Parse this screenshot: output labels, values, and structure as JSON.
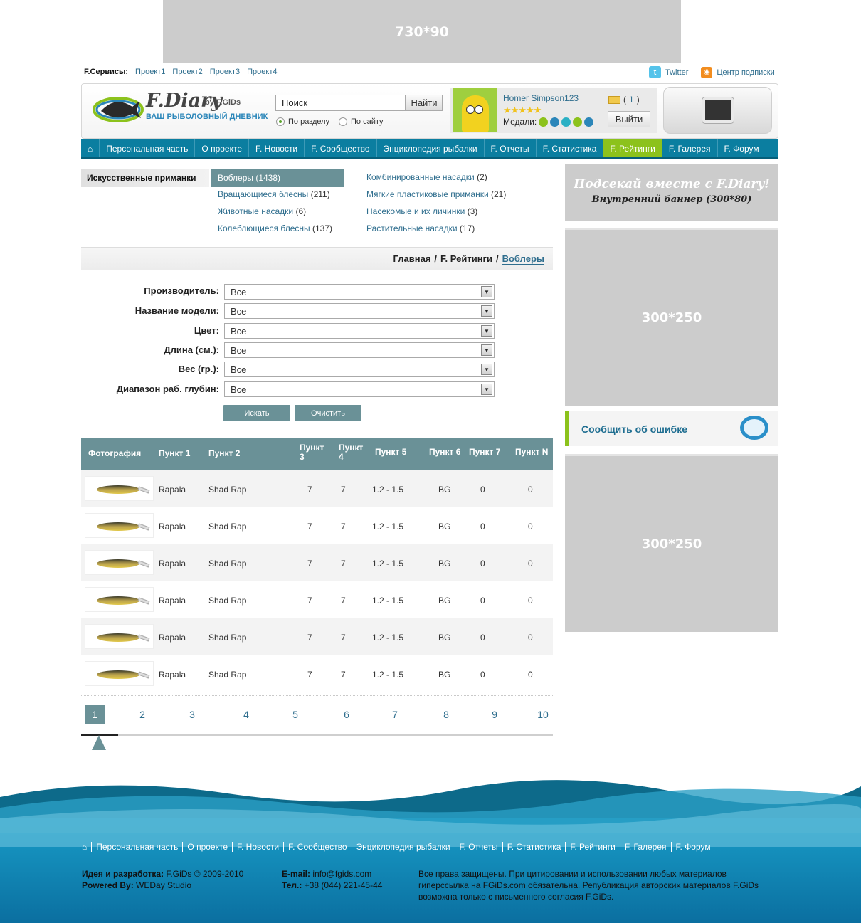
{
  "top_banner": "730*90",
  "services": {
    "label": "F.Сервисы:",
    "links": [
      "Проект1",
      "Проект2",
      "Проект3",
      "Проект4"
    ]
  },
  "social": {
    "twitter": "Twitter",
    "rss": "Центр подписки"
  },
  "logo": {
    "title": "F.Diary",
    "by": "by F.GiDs",
    "subtitle": "ВАШ РЫБОЛОВНЫЙ ДНЕВНИК"
  },
  "search": {
    "value": "Поиск",
    "button": "Найти",
    "radio1": "По разделу",
    "radio2": "По сайту"
  },
  "user": {
    "name": "Homer Simpson123",
    "medals_label": "Медали:",
    "messages": "1",
    "logout": "Выйти"
  },
  "nav": [
    "Персональная часть",
    "О проекте",
    "F. Новости",
    "F. Сообщество",
    "Энциклопедия рыбалки",
    "F. Отчеты",
    "F. Статистика",
    "F. Рейтинги",
    "F. Галерея",
    "F. Форум"
  ],
  "categories": {
    "label": "Искусственные приманки",
    "active": "Воблеры (1438)",
    "col1": [
      {
        "name": "Вращающиеся блесны",
        "count": "(211)"
      },
      {
        "name": "Животные насадки",
        "count": "(6)"
      },
      {
        "name": "Колеблющиеся блесны",
        "count": "(137)"
      }
    ],
    "col2": [
      {
        "name": "Комбинированные насадки",
        "count": "(2)"
      },
      {
        "name": "Мягкие пластиковые приманки",
        "count": "(21)"
      },
      {
        "name": "Насекомые и их личинки",
        "count": "(3)"
      },
      {
        "name": "Растительные насадки",
        "count": "(17)"
      }
    ]
  },
  "breadcrumb": {
    "home": "Главная",
    "sep": "/",
    "section": "F. Рейтинги",
    "current": "Воблеры"
  },
  "filters": [
    {
      "label": "Производитель:",
      "value": "Все"
    },
    {
      "label": "Название модели:",
      "value": "Все"
    },
    {
      "label": "Цвет:",
      "value": "Все"
    },
    {
      "label": "Длина (см.):",
      "value": "Все"
    },
    {
      "label": "Вес (гр.):",
      "value": "Все"
    },
    {
      "label": "Диапазон раб. глубин:",
      "value": "Все"
    }
  ],
  "buttons": {
    "search": "Искать",
    "clear": "Очистить"
  },
  "table": {
    "headers": [
      "Фотография",
      "Пункт 1",
      "Пункт 2",
      "Пункт 3",
      "Пункт 4",
      "Пункт 5",
      "Пункт 6",
      "Пункт 7",
      "Пункт N"
    ],
    "rows": [
      [
        "Rapala",
        "Shad Rap",
        "7",
        "7",
        "1.2 - 1.5",
        "BG",
        "0",
        "0"
      ],
      [
        "Rapala",
        "Shad Rap",
        "7",
        "7",
        "1.2 - 1.5",
        "BG",
        "0",
        "0"
      ],
      [
        "Rapala",
        "Shad Rap",
        "7",
        "7",
        "1.2 - 1.5",
        "BG",
        "0",
        "0"
      ],
      [
        "Rapala",
        "Shad Rap",
        "7",
        "7",
        "1.2 - 1.5",
        "BG",
        "0",
        "0"
      ],
      [
        "Rapala",
        "Shad Rap",
        "7",
        "7",
        "1.2 - 1.5",
        "BG",
        "0",
        "0"
      ],
      [
        "Rapala",
        "Shad Rap",
        "7",
        "7",
        "1.2 - 1.5",
        "BG",
        "0",
        "0"
      ]
    ]
  },
  "pagination": [
    "1",
    "2",
    "3",
    "4",
    "5",
    "6",
    "7",
    "8",
    "9",
    "10"
  ],
  "sidebar": {
    "banner_title": "Подсекай вместе с F.Diary!",
    "banner_sub": "Внутренний баннер (300*80)",
    "ad1": "300*250",
    "report": "Сообщить об ошибке",
    "ad2": "300*250"
  },
  "footer": {
    "nav": [
      "Персональная часть",
      "О проекте",
      "F. Новости",
      "F. Сообщество",
      "Энциклопедия рыбалки",
      "F. Отчеты",
      "F. Статистика",
      "F. Рейтинги",
      "F. Галерея",
      "F. Форум"
    ],
    "idea_label": "Идея и разработка:",
    "idea_value": "F.GiDs © 2009-2010",
    "powered_label": "Powered By:",
    "powered_value": "WEDay Studio",
    "email_label": "E-mail:",
    "email_value": "info@fgids.com",
    "tel_label": "Тел.:",
    "tel_value": "+38 (044) 221-45-44",
    "rights": "Все права защищены. При цитировании и использовании любых материалов гиперссылка на FGiDs.com обязательна. Републикация авторских материалов F.GiDs возможна только с письменного согласия F.GiDs."
  },
  "colors": {
    "nav": "#0b7ea0",
    "active": "#8cc21c",
    "accent": "#6a9197"
  }
}
